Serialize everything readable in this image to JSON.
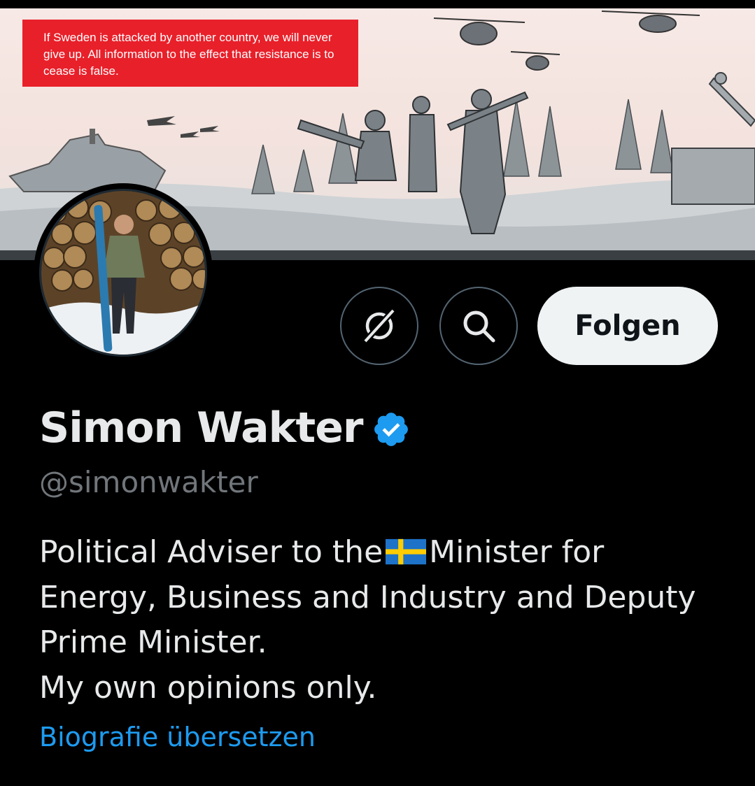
{
  "banner": {
    "notice_text": "If Sweden is attacked by another country, we will never give up. All information to the effect that resistance is to cease is false.",
    "notice_color": "#e8202a",
    "illustration_icon": "military-defense-illustration"
  },
  "profile": {
    "display_name": "Simon Wakter",
    "verified_icon": "verified-badge-icon",
    "verified_color": "#1d9bf0",
    "handle": "@simonwakter",
    "bio_lines": [
      "Political Adviser to the",
      "Minister for",
      "Energy, Business and Industry and Deputy",
      "Prime Minister.",
      "My own opinions only."
    ],
    "bio_flag_icon": "sweden-flag-icon",
    "translate_label": "Biografie übersetzen"
  },
  "actions": {
    "grok_icon": "grok-icon",
    "search_icon": "search-icon",
    "follow_label": "Folgen"
  }
}
